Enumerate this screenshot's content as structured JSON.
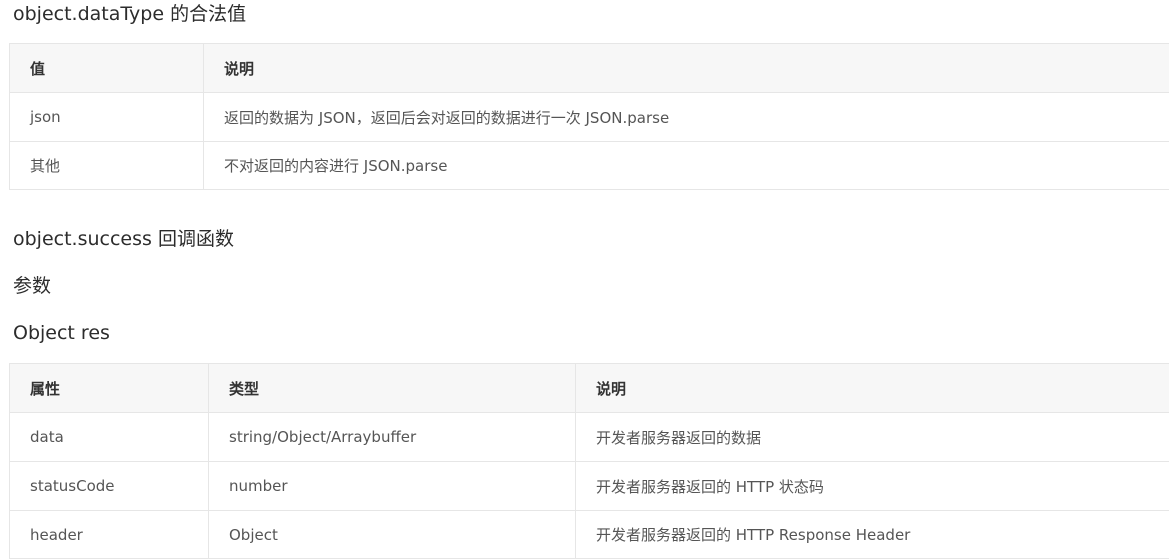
{
  "section_datatype": {
    "title": "object.dataType 的合法值",
    "table": {
      "headers": [
        "值",
        "说明"
      ],
      "rows": [
        [
          "json",
          "返回的数据为 JSON，返回后会对返回的数据进行一次 JSON.parse"
        ],
        [
          "其他",
          "不对返回的内容进行 JSON.parse"
        ]
      ]
    }
  },
  "section_success": {
    "title": "object.success 回调函数",
    "params_label": "参数",
    "object_label": "Object res",
    "table": {
      "headers": [
        "属性",
        "类型",
        "说明"
      ],
      "rows": [
        [
          "data",
          "string/Object/Arraybuffer",
          "开发者服务器返回的数据"
        ],
        [
          "statusCode",
          "number",
          "开发者服务器返回的 HTTP 状态码"
        ],
        [
          "header",
          "Object",
          "开发者服务器返回的 HTTP Response Header"
        ]
      ]
    }
  }
}
